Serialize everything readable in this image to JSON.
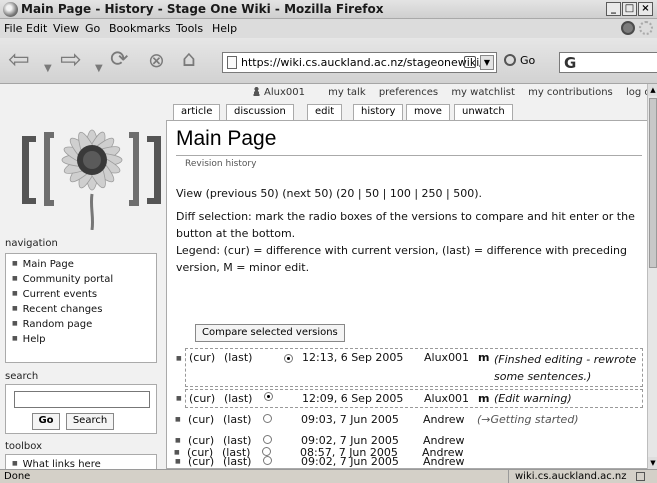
{
  "window": {
    "title": "Main Page - History - Stage One Wiki - Mozilla Firefox"
  },
  "menu": [
    "File",
    "Edit",
    "View",
    "Go",
    "Bookmarks",
    "Tools",
    "Help"
  ],
  "nav": {
    "url": "https://wiki.cs.auckland.ac.nz/stageonewiki/",
    "go_label": "Go",
    "search_glyph": "G"
  },
  "personal": {
    "user": "Alux001",
    "links": [
      "my talk",
      "preferences",
      "my watchlist",
      "my contributions",
      "log out"
    ]
  },
  "tabs": [
    "article",
    "discussion",
    "edit",
    "history",
    "move",
    "unwatch"
  ],
  "sidebar": {
    "navigation_heading": "navigation",
    "nav_items": [
      "Main Page",
      "Community portal",
      "Current events",
      "Recent changes",
      "Random page",
      "Help"
    ],
    "search_heading": "search",
    "go_button": "Go",
    "search_button": "Search",
    "toolbox_heading": "toolbox",
    "toolbox_partial": "What links here"
  },
  "content": {
    "title": "Main Page",
    "subtitle": "Revision history",
    "view_line": "View (previous 50) (next 50) (20 | 50 | 100 | 250 | 500).",
    "diff_line": "Diff selection: mark the radio boxes of the versions to compare and hit enter or the button at the bottom.",
    "legend_line": "Legend: (cur) = difference with current version, (last) = difference with preceding version, M = minor edit.",
    "compare_button": "Compare selected versions",
    "history": [
      {
        "cur": "(cur)",
        "last": "(last)",
        "radio": "on",
        "date": "12:13, 6 Sep 2005",
        "user": "Alux001",
        "minor": "m",
        "comment": "(Finshed editing - rewrote some sentences.)"
      },
      {
        "cur": "(cur)",
        "last": "(last)",
        "radio": "on",
        "date": "12:09, 6 Sep 2005",
        "user": "Alux001",
        "minor": "m",
        "comment": "(Edit warning)"
      },
      {
        "cur": "(cur)",
        "last": "(last)",
        "radio": "off",
        "date": "09:03, 7 Jun 2005",
        "user": "Andrew",
        "minor": "",
        "comment": "(→Getting started)"
      },
      {
        "cur": "(cur)",
        "last": "(last)",
        "radio": "off",
        "date": "09:02, 7 Jun 2005",
        "user": "Andrew",
        "minor": "",
        "comment": ""
      },
      {
        "cur": "(cur)",
        "last": "(last)",
        "radio": "off",
        "date": "09:02, 7 Jun 2005",
        "user": "Andrew",
        "minor": "",
        "comment": ""
      },
      {
        "cur": "(cur)",
        "last": "(last)",
        "radio": "off",
        "date": "08:57, 7 Jun 2005",
        "user": "Andrew",
        "minor": "",
        "comment": ""
      }
    ]
  },
  "status": {
    "text": "Done",
    "host": "wiki.cs.auckland.ac.nz"
  }
}
